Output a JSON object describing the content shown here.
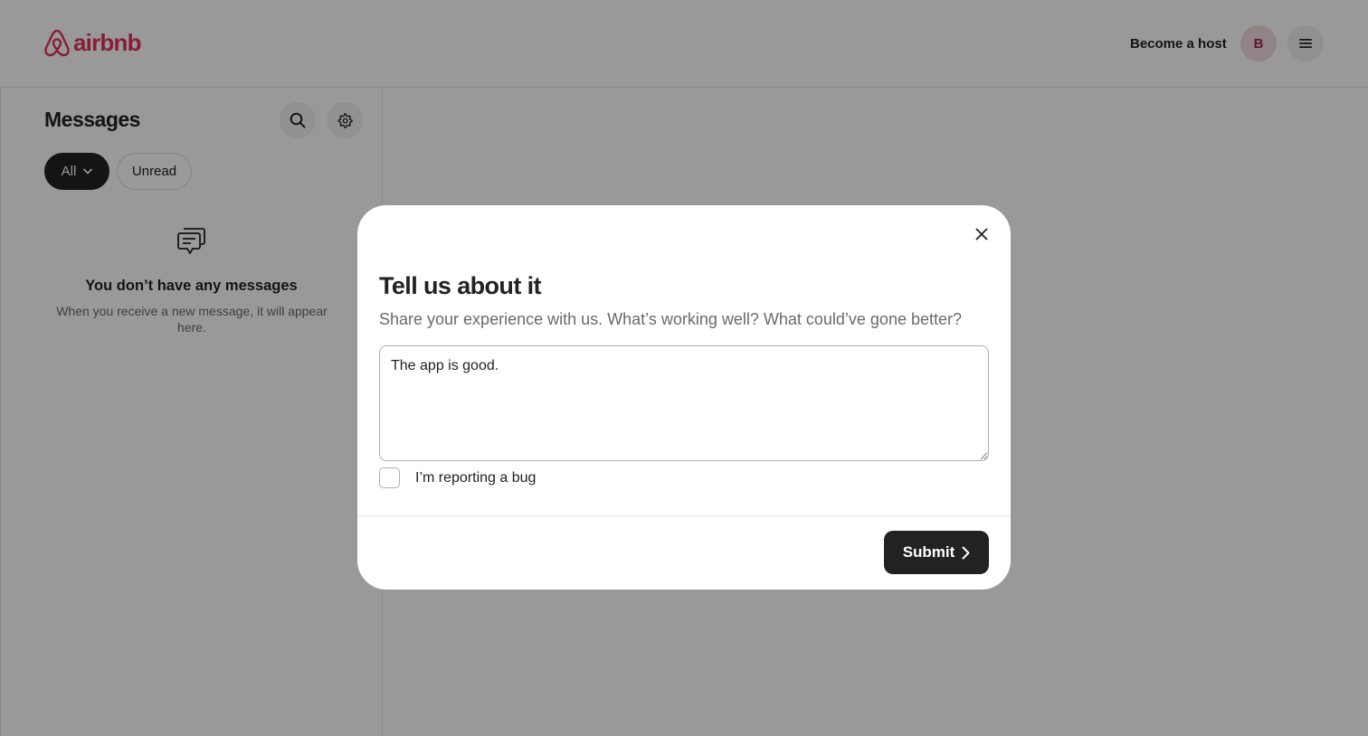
{
  "brand": {
    "name": "airbnb",
    "color": "#e0325b"
  },
  "header": {
    "become_host_label": "Become a host",
    "avatar_initial": "B",
    "menu_icon": "hamburger-menu-icon"
  },
  "sidebar": {
    "title": "Messages",
    "search_icon": "search-icon",
    "settings_icon": "gear-icon",
    "filters": [
      {
        "label": "All",
        "selected": true
      },
      {
        "label": "Unread",
        "selected": false
      }
    ],
    "empty_state": {
      "icon": "chat-bubbles-icon",
      "title": "You don’t have any messages",
      "subtitle": "When you receive a new message, it will appear here."
    }
  },
  "modal": {
    "title": "Tell us about it",
    "subtitle": "Share your experience with us. What’s working well? What could’ve gone better?",
    "feedback_value": "The app is good.",
    "bug_checkbox_label": "I’m reporting a bug",
    "bug_checked": false,
    "submit_label": "Submit"
  }
}
